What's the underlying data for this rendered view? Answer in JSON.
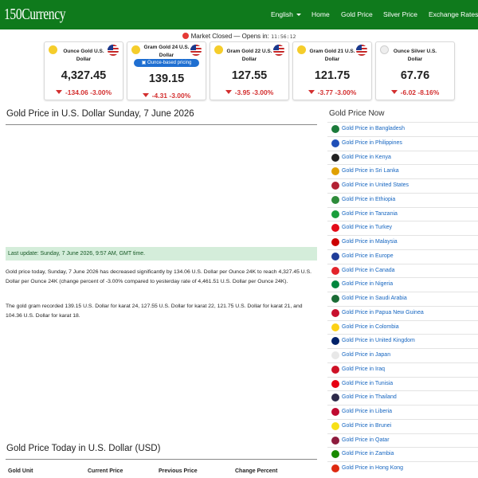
{
  "header": {
    "logo": "150Currency",
    "nav": [
      {
        "label": "English",
        "dropdown": true
      },
      {
        "label": "Home"
      },
      {
        "label": "Gold Price"
      },
      {
        "label": "Silver Price"
      },
      {
        "label": "Exchange Rates"
      }
    ]
  },
  "market": {
    "status": "Market Closed — Opens in:",
    "countdown": "11:56:12",
    "status_color": "#e53935"
  },
  "cards": [
    {
      "title": "Ounce Gold U.S. Dollar",
      "value": "4,327.45",
      "change": "-134.06 -3.00%",
      "metal": "gold"
    },
    {
      "title": "Gram Gold 24 U.S. Dollar",
      "pill": "Ounce-based pricing",
      "value": "139.15",
      "change": "-4.31 -3.00%",
      "metal": "gold"
    },
    {
      "title": "Gram Gold 22 U.S. Dollar",
      "value": "127.55",
      "change": "-3.95 -3.00%",
      "metal": "gold"
    },
    {
      "title": "Gram Gold 21 U.S. Dollar",
      "value": "121.75",
      "change": "-3.77 -3.00%",
      "metal": "gold"
    },
    {
      "title": "Ounce Silver U.S. Dollar",
      "value": "67.76",
      "change": "-6.02 -8.16%",
      "metal": "silver"
    }
  ],
  "main": {
    "title": "Gold Price in U.S. Dollar Sunday, 7 June 2026",
    "last_update": "Last update: Sunday, 7 June 2026, 9:57 AM, GMT time.",
    "paragraph1": "Gold price today, Sunday, 7 June 2026 has decreased significantly by 134.06 U.S. Dollar per Ounce 24K to reach 4,327.45 U.S. Dollar per Ounce 24K (change percent of -3.00% compared to yesterday rate of 4,461.51 U.S. Dollar per Ounce 24K).",
    "paragraph2": "The gold gram recorded 139.15 U.S. Dollar for karat 24, 127.55 U.S. Dollar for karat 22, 121.75 U.S. Dollar for karat 21, and 104.36 U.S. Dollar for karat 18.",
    "table_title": "Gold Price Today in U.S. Dollar (USD)",
    "table_headers": [
      "Gold Unit",
      "Current Price",
      "Previous Price",
      "Change Percent"
    ]
  },
  "sidebar": {
    "title": "Gold Price Now",
    "items": [
      {
        "label": "Gold Price in Bangladesh",
        "flag": "#1b7a3a"
      },
      {
        "label": "Gold Price in Philippines",
        "flag": "#1f4fb8"
      },
      {
        "label": "Gold Price in Kenya",
        "flag": "#222222"
      },
      {
        "label": "Gold Price in Sri Lanka",
        "flag": "#e0a000"
      },
      {
        "label": "Gold Price in United States",
        "flag": "#b22234"
      },
      {
        "label": "Gold Price in Ethiopia",
        "flag": "#2e8b3a"
      },
      {
        "label": "Gold Price in Tanzania",
        "flag": "#1a9e3c"
      },
      {
        "label": "Gold Price in Turkey",
        "flag": "#e30a17"
      },
      {
        "label": "Gold Price in Malaysia",
        "flag": "#cc0001"
      },
      {
        "label": "Gold Price in Europe",
        "flag": "#1f3d99"
      },
      {
        "label": "Gold Price in Canada",
        "flag": "#e3242b"
      },
      {
        "label": "Gold Price in Nigeria",
        "flag": "#00873e"
      },
      {
        "label": "Gold Price in Saudi Arabia",
        "flag": "#1a6b35"
      },
      {
        "label": "Gold Price in Papua New Guinea",
        "flag": "#c8102e"
      },
      {
        "label": "Gold Price in Colombia",
        "flag": "#fcd116"
      },
      {
        "label": "Gold Price in United Kingdom",
        "flag": "#012169"
      },
      {
        "label": "Gold Price in Japan",
        "flag": "#e8e8e8"
      },
      {
        "label": "Gold Price in Iraq",
        "flag": "#ce1126"
      },
      {
        "label": "Gold Price in Tunisia",
        "flag": "#e70013"
      },
      {
        "label": "Gold Price in Thailand",
        "flag": "#2d2a4a"
      },
      {
        "label": "Gold Price in Liberia",
        "flag": "#bf0a30"
      },
      {
        "label": "Gold Price in Brunei",
        "flag": "#f7e017"
      },
      {
        "label": "Gold Price in Qatar",
        "flag": "#8d1b3d"
      },
      {
        "label": "Gold Price in Zambia",
        "flag": "#198a00"
      },
      {
        "label": "Gold Price in Hong Kong",
        "flag": "#de2910"
      }
    ]
  }
}
